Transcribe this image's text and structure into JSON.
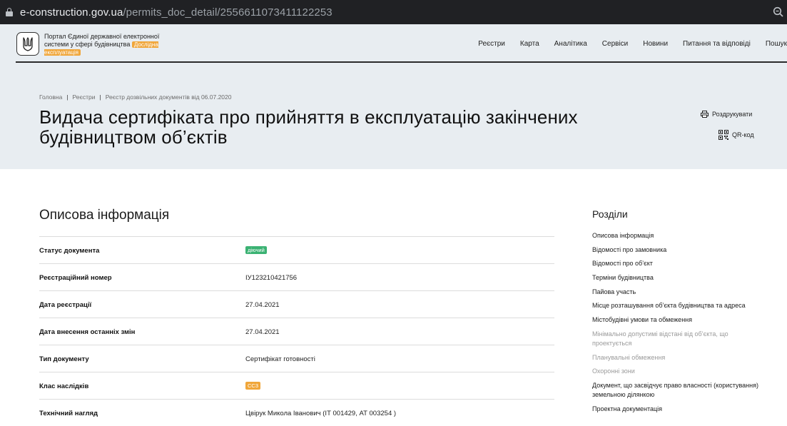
{
  "browser": {
    "url_host": "e-construction.gov.ua",
    "url_path": "/permits_doc_detail/2556611073411122253"
  },
  "header": {
    "portal_title": "Портал Єдиної державної електронної системи у сфері будівництва",
    "badge": "Дослідна експлуатація",
    "nav": [
      "Реєстри",
      "Карта",
      "Аналітика",
      "Сервіси",
      "Новини",
      "Питання та відповіді",
      "Пошук"
    ]
  },
  "breadcrumb": [
    "Головна",
    "Реєстри",
    "Реєстр дозвільних документів від 06.07.2020"
  ],
  "title": "Видача сертифіката про прийняття в експлуатацію закінчених будівництвом об’єктів",
  "actions": {
    "print": "Роздрукувати",
    "qr": "QR-код"
  },
  "main": {
    "section_title": "Описова інформація",
    "rows": [
      {
        "label": "Статус документа",
        "value": "діючий",
        "type": "badge-green"
      },
      {
        "label": "Реєстраційний номер",
        "value": "ІУ123210421756",
        "type": "text"
      },
      {
        "label": "Дата реєстрації",
        "value": "27.04.2021",
        "type": "text"
      },
      {
        "label": "Дата внесення останніх змін",
        "value": "27.04.2021",
        "type": "text"
      },
      {
        "label": "Тип документу",
        "value": "Сертифікат готовності",
        "type": "text"
      },
      {
        "label": "Клас наслідків",
        "value": "СС3",
        "type": "badge-orange"
      },
      {
        "label": "Технічний нагляд",
        "value": "Цвірук Микола Іванович (ІТ 001429, АТ 003254 )",
        "type": "text"
      }
    ]
  },
  "sections": {
    "title": "Розділи",
    "items": [
      {
        "label": "Описова інформація",
        "muted": false
      },
      {
        "label": "Відомості про замовника",
        "muted": false
      },
      {
        "label": "Відомості про об’єкт",
        "muted": false
      },
      {
        "label": "Терміни будівництва",
        "muted": false
      },
      {
        "label": "Пайова участь",
        "muted": false
      },
      {
        "label": "Місце розташування об’єкта будівництва та адреса",
        "muted": false
      },
      {
        "label": "Містобудівні умови та обмеження",
        "muted": false
      },
      {
        "label": "Мінімально допустимі відстані від об’єкта, що проектується",
        "muted": true
      },
      {
        "label": "Планувальні обмеження",
        "muted": true
      },
      {
        "label": "Охоронні зони",
        "muted": true
      },
      {
        "label": "Документ, що засвідчує право власності (користування) земельною ділянкою",
        "muted": false
      },
      {
        "label": "Проектна документація",
        "muted": false
      }
    ]
  },
  "colors": {
    "status_green": "#3bb273",
    "accent_orange": "#f0a63a",
    "header_bg": "#e8edf1",
    "browser_bar": "#202124"
  }
}
